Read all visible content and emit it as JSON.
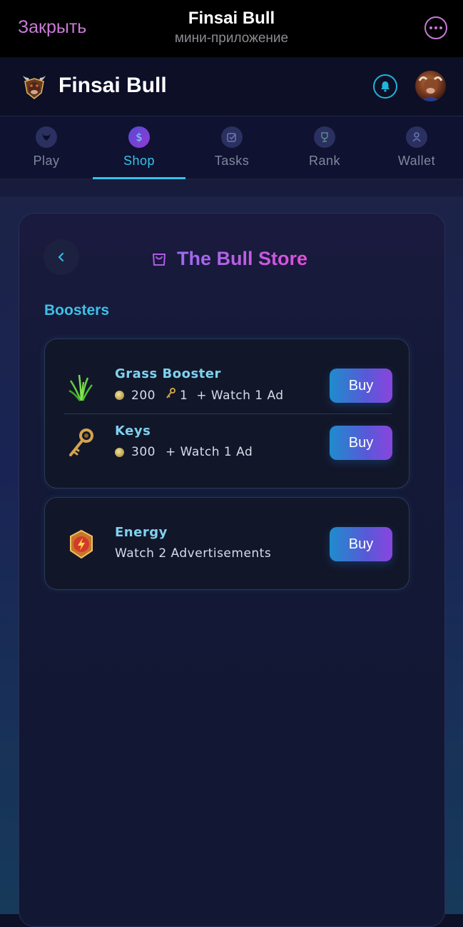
{
  "telegram": {
    "close_label": "Закрыть",
    "title": "Finsai Bull",
    "subtitle": "мини-приложение"
  },
  "header": {
    "title": "Finsai Bull"
  },
  "tabs": [
    {
      "label": "Play",
      "icon": "bull-icon",
      "active": false
    },
    {
      "label": "Shop",
      "icon": "dollar-icon",
      "active": true
    },
    {
      "label": "Tasks",
      "icon": "checkbox-icon",
      "active": false
    },
    {
      "label": "Rank",
      "icon": "trophy-icon",
      "active": false
    },
    {
      "label": "Wallet",
      "icon": "user-icon",
      "active": false
    }
  ],
  "store": {
    "title": "The Bull Store",
    "section": "Boosters",
    "items": [
      {
        "name": "Grass Booster",
        "coins": "200",
        "keys": "1",
        "extra": "+ Watch 1 Ad",
        "buy_label": "Buy"
      },
      {
        "name": "Keys",
        "coins": "300",
        "extra": "+ Watch 1 Ad",
        "buy_label": "Buy"
      },
      {
        "name": "Energy",
        "extra": "Watch 2 Advertisements",
        "buy_label": "Buy"
      }
    ]
  },
  "colors": {
    "accent": "#35c3e8",
    "title_gradient_start": "#9a6cf0",
    "title_gradient_end": "#e04fd8",
    "telegram_action": "#c97ad8"
  }
}
